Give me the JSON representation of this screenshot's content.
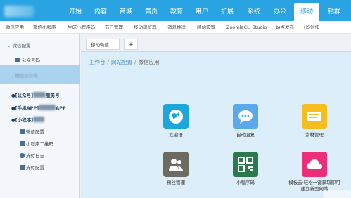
{
  "nav": {
    "items": [
      "开始",
      "内容",
      "商城",
      "黄页",
      "教育",
      "用户",
      "扩展",
      "系统",
      "办公",
      "移动",
      "钻群"
    ],
    "active_index": 9
  },
  "subnav": {
    "items": [
      "微信应用",
      "微信小程序",
      "生成小程序码",
      "节日管理",
      "移动浏览器",
      "消息推送",
      "超站设置",
      "ZoomlaCLI Studio",
      "站点发布",
      "H5创作"
    ]
  },
  "sidebar": {
    "group1": "微信配置",
    "item_gzh": "公众号码",
    "group2": "微信公众号",
    "item_service_prefix": "[公众号]",
    "item_service_suffix": "服务号",
    "item_app_prefix": "[手机APP]",
    "item_app_suffix": "APP",
    "item_mini_prefix": "[小程序]",
    "sub_items": [
      "微信配置",
      "小程序二维码",
      "支付日志",
      "支付配置"
    ]
  },
  "tabs": {
    "tab1": "移动微信...",
    "add": "+"
  },
  "breadcrumb": {
    "home": "工作台",
    "mid": "网站配置",
    "current": "微信应用"
  },
  "apps": [
    {
      "label": "欢迎语",
      "icon": "globe-icon",
      "color": "#1da6db"
    },
    {
      "label": "自动回复",
      "icon": "chat-bubble-icon",
      "color": "#5aa7ea"
    },
    {
      "label": "素材管理",
      "icon": "material-card-icon",
      "color": "#f5be1e"
    },
    {
      "label": "粉丝管理",
      "icon": "users-icon",
      "color": "#6d6a61"
    },
    {
      "label": "小程序码",
      "icon": "qr-code-icon",
      "color": "#2b7a4c"
    },
    {
      "label": "模板云·轻松一键获取即可",
      "label2": "建立新型网站",
      "icon": "cloud-icon",
      "color": "#ec2e79"
    }
  ],
  "colors": {
    "nav_bg": "#2aa3e3",
    "content_bg": "#dceefa",
    "sidebar_highlight": "#a9d3ef"
  }
}
